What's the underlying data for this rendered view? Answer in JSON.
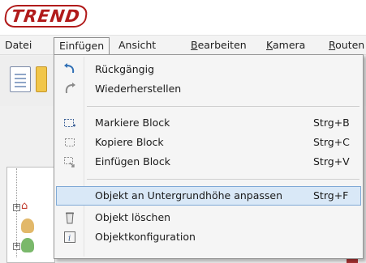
{
  "logo": {
    "text": "TREND"
  },
  "menubar": {
    "items": [
      {
        "label": "Datei",
        "underline": ""
      },
      {
        "label": "Einfügen",
        "underline": ""
      },
      {
        "label": "Ansicht",
        "underline": ""
      },
      {
        "label_pre": "",
        "label_ul": "B",
        "label_post": "earbeiten"
      },
      {
        "label_pre": "",
        "label_ul": "K",
        "label_post": "amera"
      },
      {
        "label_pre": "",
        "label_ul": "R",
        "label_post": "outen"
      }
    ]
  },
  "dropdown": {
    "items": [
      {
        "label": "Rückgängig",
        "shortcut": "",
        "icon": "undo-icon"
      },
      {
        "label": "Wiederherstellen",
        "shortcut": "",
        "icon": "redo-icon"
      },
      {
        "label": "Markiere Block",
        "shortcut": "Strg+B",
        "icon": "mark-block-icon"
      },
      {
        "label": "Kopiere Block",
        "shortcut": "Strg+C",
        "icon": "copy-block-icon"
      },
      {
        "label": "Einfügen Block",
        "shortcut": "Strg+V",
        "icon": "paste-block-icon"
      },
      {
        "label": "Objekt an Untergrundhöhe anpassen",
        "shortcut": "Strg+F",
        "icon": ""
      },
      {
        "label": "Objekt löschen",
        "shortcut": "",
        "icon": "delete-object-icon"
      },
      {
        "label": "Objektkonfiguration",
        "shortcut": "",
        "icon": "object-config-icon"
      }
    ]
  },
  "colors": {
    "logo": "#b11b1b",
    "highlight_bg": "#d9e8f7",
    "highlight_border": "#7fa9d6"
  }
}
